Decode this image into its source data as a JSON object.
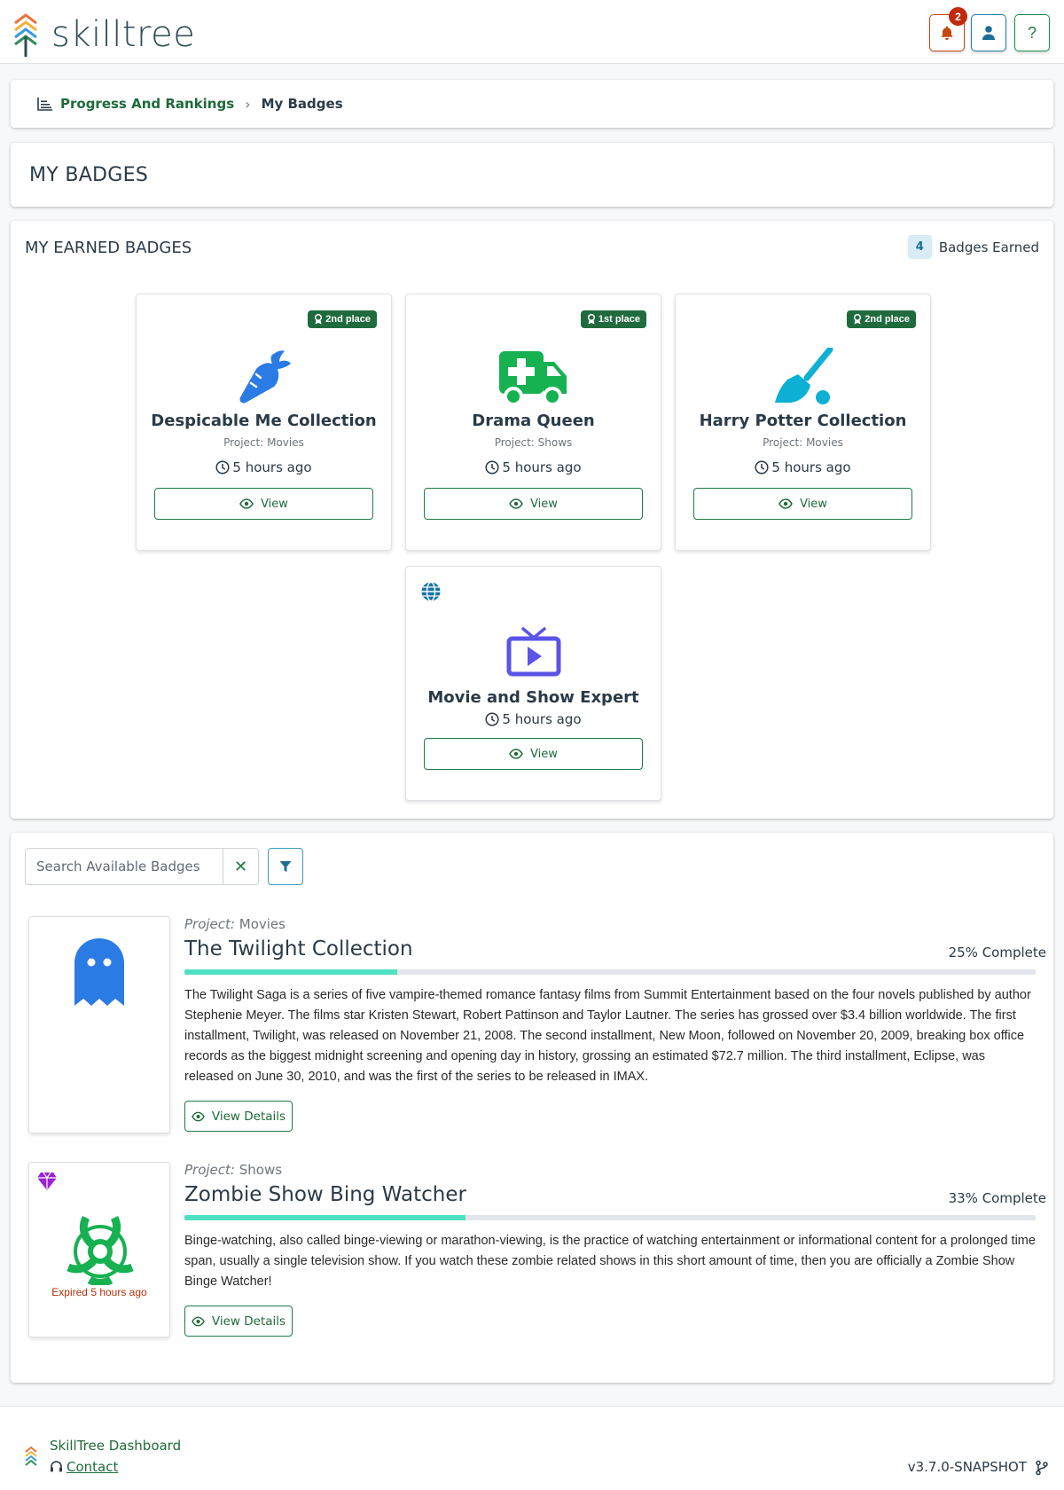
{
  "app": {
    "name": "skilltree",
    "notification_count": "2",
    "help_label": "?"
  },
  "breadcrumb": {
    "parent": "Progress And Rankings",
    "current": "My Badges"
  },
  "page": {
    "title": "MY BADGES"
  },
  "earned": {
    "title": "MY EARNED BADGES",
    "count": "4",
    "count_label": "Badges Earned",
    "badges": [
      {
        "name": "Despicable Me Collection",
        "project": "Project: Movies",
        "time": "5 hours ago",
        "place": "2nd place",
        "icon": "carrot-icon",
        "color": "#2b7be4",
        "view_label": "View"
      },
      {
        "name": "Drama Queen",
        "project": "Project: Shows",
        "time": "5 hours ago",
        "place": "1st place",
        "icon": "ambulance-icon",
        "color": "#16b150",
        "view_label": "View"
      },
      {
        "name": "Harry Potter Collection",
        "project": "Project: Movies",
        "time": "5 hours ago",
        "place": "2nd place",
        "icon": "broom-icon",
        "color": "#0db0d4",
        "view_label": "View"
      },
      {
        "name": "Movie and Show Expert",
        "time": "5 hours ago",
        "icon": "tv-icon",
        "color": "#5b54e6",
        "view_label": "View"
      }
    ]
  },
  "available": {
    "search_placeholder": "Search Available Badges",
    "project_label": "Project:",
    "items": [
      {
        "project": "Movies",
        "name": "The Twilight Collection",
        "percent_label": "25% Complete",
        "progress": 25,
        "icon": "ghost-icon",
        "description": "The Twilight Saga is a series of five vampire-themed romance fantasy films from Summit Entertainment based on the four novels published by author Stephenie Meyer. The films star Kristen Stewart, Robert Pattinson and Taylor Lautner. The series has grossed over $3.4 billion worldwide. The first installment, Twilight, was released on November 21, 2008. The second installment, New Moon, followed on November 20, 2009, breaking box office records as the biggest midnight screening and opening day in history, grossing an estimated $72.7 million. The third installment, Eclipse, was released on June 30, 2010, and was the first of the series to be released in IMAX.",
        "details_label": "View Details"
      },
      {
        "project": "Shows",
        "name": "Zombie Show Bing Watcher",
        "percent_label": "33% Complete",
        "progress": 33,
        "icon": "biohazard-icon",
        "expired": "Expired 5 hours ago",
        "description": "Binge-watching, also called binge-viewing or marathon-viewing, is the practice of watching entertainment or informational content for a prolonged time span, usually a single television show. If you watch these zombie related shows in this short amount of time, then you are officially a Zombie Show Binge Watcher!",
        "details_label": "View Details"
      }
    ]
  },
  "footer": {
    "title": "SkillTree Dashboard",
    "contact": "Contact",
    "version": "v3.7.0-SNAPSHOT"
  },
  "colors": {
    "brand_green": "#1e6a3b",
    "progress": "#4fe0c4",
    "expired": "#b3300b"
  }
}
